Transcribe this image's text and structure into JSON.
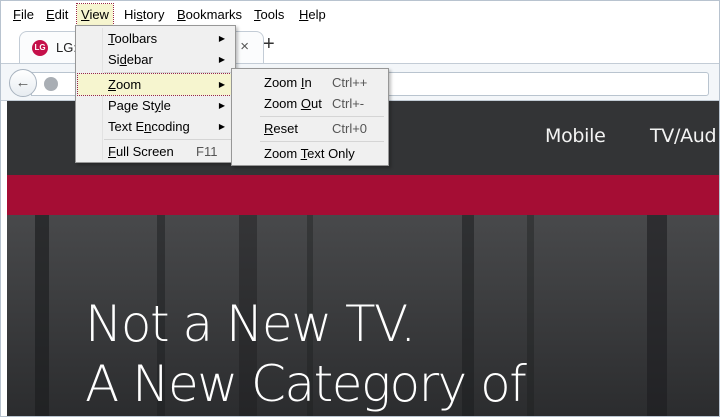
{
  "menubar": [
    {
      "pre": "",
      "mn": "F",
      "post": "ile"
    },
    {
      "pre": "",
      "mn": "E",
      "post": "dit"
    },
    {
      "pre": "",
      "mn": "V",
      "post": "iew"
    },
    {
      "pre": "Hi",
      "mn": "s",
      "post": "tory"
    },
    {
      "pre": "",
      "mn": "B",
      "post": "ookmarks"
    },
    {
      "pre": "",
      "mn": "T",
      "post": "ools"
    },
    {
      "pre": "",
      "mn": "H",
      "post": "elp"
    }
  ],
  "tab": {
    "favicon": "LG",
    "title": "LG:",
    "close": "×"
  },
  "newtab": "+",
  "back_icon": "←",
  "view_menu": [
    {
      "pre": "",
      "mn": "T",
      "post": "oolbars",
      "shortcut": "",
      "submenu": true
    },
    {
      "pre": "Si",
      "mn": "d",
      "post": "ebar",
      "shortcut": "",
      "submenu": true
    },
    {
      "pre": "",
      "mn": "Z",
      "post": "oom",
      "shortcut": "",
      "submenu": true
    },
    {
      "pre": "Page St",
      "mn": "y",
      "post": "le",
      "shortcut": "",
      "submenu": true
    },
    {
      "pre": "Text E",
      "mn": "n",
      "post": "coding",
      "shortcut": "",
      "submenu": true
    },
    {
      "pre": "",
      "mn": "F",
      "post": "ull Screen",
      "shortcut": "F11",
      "submenu": false
    }
  ],
  "zoom_menu": [
    {
      "pre": "Zoom ",
      "mn": "I",
      "post": "n",
      "shortcut": "Ctrl++"
    },
    {
      "pre": "Zoom ",
      "mn": "O",
      "post": "ut",
      "shortcut": "Ctrl+-"
    },
    {
      "pre": "",
      "mn": "R",
      "post": "eset",
      "shortcut": "Ctrl+0"
    },
    {
      "pre": "Zoom ",
      "mn": "T",
      "post": "ext Only",
      "shortcut": ""
    }
  ],
  "site_nav": [
    "Mobile",
    "TV/Aud"
  ],
  "hero": {
    "line1": "Not a New TV.",
    "line2": "A New Category of"
  },
  "colors": {
    "accent_red": "#a50d34",
    "highlight": "#f6f5cf",
    "favicon": "#c5104a"
  }
}
